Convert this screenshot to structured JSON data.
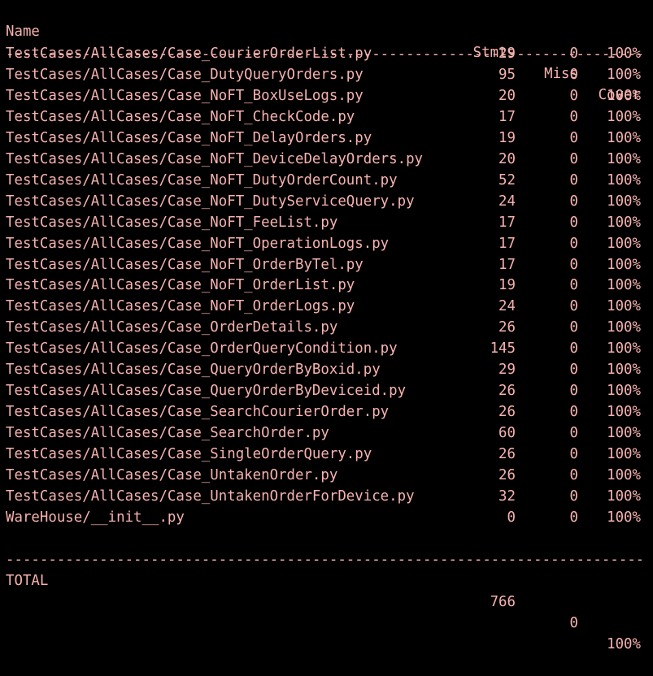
{
  "colors": {
    "background": "#000000",
    "text": "#f6b2ae"
  },
  "header": {
    "name": "Name",
    "stmts": "Stmts",
    "miss": "Miss",
    "cover": "Cover"
  },
  "separator": "-------------------------------------------------------------------------------------------------------------",
  "rows": [
    {
      "name": "TestCases/AllCases/Case_CourierOrderList.py",
      "stmts": "29",
      "miss": "0",
      "cover": "100%"
    },
    {
      "name": "TestCases/AllCases/Case_DutyQueryOrders.py",
      "stmts": "95",
      "miss": "0",
      "cover": "100%"
    },
    {
      "name": "TestCases/AllCases/Case_NoFT_BoxUseLogs.py",
      "stmts": "20",
      "miss": "0",
      "cover": "100%"
    },
    {
      "name": "TestCases/AllCases/Case_NoFT_CheckCode.py",
      "stmts": "17",
      "miss": "0",
      "cover": "100%"
    },
    {
      "name": "TestCases/AllCases/Case_NoFT_DelayOrders.py",
      "stmts": "19",
      "miss": "0",
      "cover": "100%"
    },
    {
      "name": "TestCases/AllCases/Case_NoFT_DeviceDelayOrders.py",
      "stmts": "20",
      "miss": "0",
      "cover": "100%"
    },
    {
      "name": "TestCases/AllCases/Case_NoFT_DutyOrderCount.py",
      "stmts": "52",
      "miss": "0",
      "cover": "100%"
    },
    {
      "name": "TestCases/AllCases/Case_NoFT_DutyServiceQuery.py",
      "stmts": "24",
      "miss": "0",
      "cover": "100%"
    },
    {
      "name": "TestCases/AllCases/Case_NoFT_FeeList.py",
      "stmts": "17",
      "miss": "0",
      "cover": "100%"
    },
    {
      "name": "TestCases/AllCases/Case_NoFT_OperationLogs.py",
      "stmts": "17",
      "miss": "0",
      "cover": "100%"
    },
    {
      "name": "TestCases/AllCases/Case_NoFT_OrderByTel.py",
      "stmts": "17",
      "miss": "0",
      "cover": "100%"
    },
    {
      "name": "TestCases/AllCases/Case_NoFT_OrderList.py",
      "stmts": "19",
      "miss": "0",
      "cover": "100%"
    },
    {
      "name": "TestCases/AllCases/Case_NoFT_OrderLogs.py",
      "stmts": "24",
      "miss": "0",
      "cover": "100%"
    },
    {
      "name": "TestCases/AllCases/Case_OrderDetails.py",
      "stmts": "26",
      "miss": "0",
      "cover": "100%"
    },
    {
      "name": "TestCases/AllCases/Case_OrderQueryCondition.py",
      "stmts": "145",
      "miss": "0",
      "cover": "100%"
    },
    {
      "name": "TestCases/AllCases/Case_QueryOrderByBoxid.py",
      "stmts": "29",
      "miss": "0",
      "cover": "100%"
    },
    {
      "name": "TestCases/AllCases/Case_QueryOrderByDeviceid.py",
      "stmts": "26",
      "miss": "0",
      "cover": "100%"
    },
    {
      "name": "TestCases/AllCases/Case_SearchCourierOrder.py",
      "stmts": "26",
      "miss": "0",
      "cover": "100%"
    },
    {
      "name": "TestCases/AllCases/Case_SearchOrder.py",
      "stmts": "60",
      "miss": "0",
      "cover": "100%"
    },
    {
      "name": "TestCases/AllCases/Case_SingleOrderQuery.py",
      "stmts": "26",
      "miss": "0",
      "cover": "100%"
    },
    {
      "name": "TestCases/AllCases/Case_UntakenOrder.py",
      "stmts": "26",
      "miss": "0",
      "cover": "100%"
    },
    {
      "name": "TestCases/AllCases/Case_UntakenOrderForDevice.py",
      "stmts": "32",
      "miss": "0",
      "cover": "100%"
    },
    {
      "name": "WareHouse/__init__.py",
      "stmts": "0",
      "miss": "0",
      "cover": "100%"
    }
  ],
  "total": {
    "name": "TOTAL",
    "stmts": "766",
    "miss": "0",
    "cover": "100%"
  }
}
